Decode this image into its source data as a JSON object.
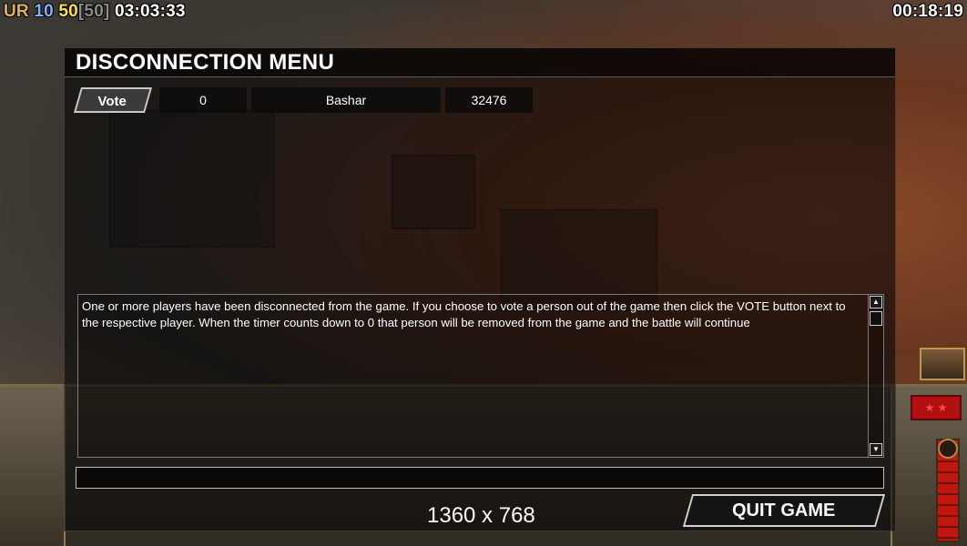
{
  "hud": {
    "faction": "UR",
    "count_a": "10",
    "count_b": "50",
    "count_c": "[50]",
    "clock": "03:03:33",
    "timer": "00:18:19"
  },
  "dialog": {
    "title": "DISCONNECTION MENU",
    "player": {
      "vote_label": "Vote",
      "vote_count": "0",
      "name": "Bashar",
      "ping": "32476"
    },
    "message": "One or more players have been disconnected from the game. If you choose to vote a person out of the game then click the VOTE button next to the respective player. When the timer counts down to 0 that person will be removed from the game and the battle will continue",
    "chat_value": "",
    "resolution": "1360 x 768",
    "quit_label": "QUIT GAME"
  },
  "colors": {
    "dialog_bg": "#0a0606",
    "accent_red": "#b01010"
  }
}
